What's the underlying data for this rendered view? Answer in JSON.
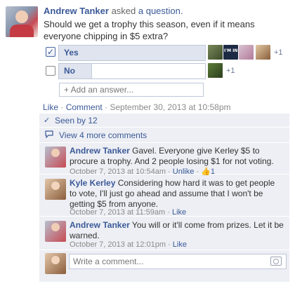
{
  "post": {
    "author": "Andrew Tanker",
    "action_text": " asked ",
    "action_link": "a question.",
    "question": "Should we get a trophy this season, even if it means everyone chipping in $5 extra?"
  },
  "poll": {
    "options": [
      {
        "label": "Yes",
        "checked": true,
        "fraction": 1.0,
        "more_voters": "+1"
      },
      {
        "label": "No",
        "checked": false,
        "fraction": 0.22,
        "more_voters": "+1"
      }
    ],
    "add_answer_placeholder": "+ Add an answer..."
  },
  "post_meta": {
    "like": "Like",
    "sep": " · ",
    "comment": "Comment",
    "timestamp": "September 30, 2013 at 10:58pm"
  },
  "seen": {
    "text": "Seen by 12"
  },
  "more_comments": {
    "text": "View 4 more comments"
  },
  "comments": [
    {
      "author": "Andrew Tanker",
      "text": " Gavel. Everyone give Kerley $5 to procure a trophy. And 2 people losing $1 for not voting.",
      "timestamp": "October 7, 2013 at 10:54am",
      "sep": " · ",
      "unlike": "Unlike",
      "sep2": " · ",
      "like_count": "1"
    },
    {
      "author": "Kyle Kerley",
      "text": " Considering how hard it was to get people to vote, I'll just go ahead and assume that I won't be getting $5 from anyone.",
      "timestamp": "October 7, 2013 at 11:59am",
      "sep": " · ",
      "like": "Like"
    },
    {
      "author": "Andrew Tanker",
      "text": " You will or it'll come from prizes. Let it be warned.",
      "timestamp": "October 7, 2013 at 12:01pm",
      "sep": " · ",
      "like": "Like"
    }
  ],
  "composer": {
    "placeholder": "Write a comment..."
  },
  "colors": {
    "link": "#3b5998",
    "ufi_bg": "#edeff4"
  },
  "icons": [
    "checkmark-icon",
    "thumbs-up-icon",
    "comment-bubble-icon",
    "camera-icon"
  ]
}
